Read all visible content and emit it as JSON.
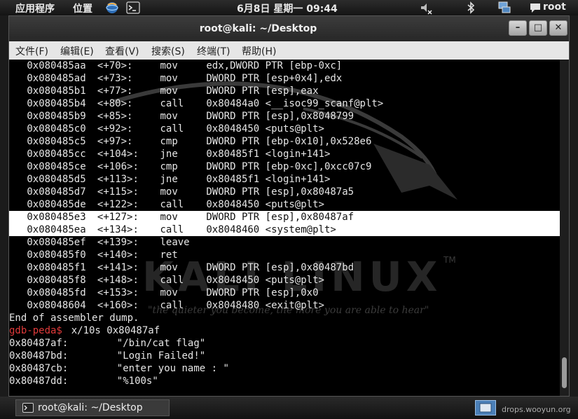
{
  "top_panel": {
    "apps_menu": "应用程序",
    "places_menu": "位置",
    "clock": "6月8日 星期一 09:44",
    "user": "root"
  },
  "window": {
    "title": "root@kali: ~/Desktop",
    "controls": {
      "minimize": "–",
      "maximize": "□",
      "close": "✕"
    }
  },
  "menubar": [
    "文件(F)",
    "编辑(E)",
    "查看(V)",
    "搜索(S)",
    "终端(T)",
    "帮助(H)"
  ],
  "disassembly": [
    {
      "addr": "0x080485aa",
      "off": "<+70>:",
      "op": "mov",
      "args": "edx,DWORD PTR [ebp-0xc]"
    },
    {
      "addr": "0x080485ad",
      "off": "<+73>:",
      "op": "mov",
      "args": "DWORD PTR [esp+0x4],edx"
    },
    {
      "addr": "0x080485b1",
      "off": "<+77>:",
      "op": "mov",
      "args": "DWORD PTR [esp],eax"
    },
    {
      "addr": "0x080485b4",
      "off": "<+80>:",
      "op": "call",
      "args": "0x80484a0 <__isoc99_scanf@plt>"
    },
    {
      "addr": "0x080485b9",
      "off": "<+85>:",
      "op": "mov",
      "args": "DWORD PTR [esp],0x8048799"
    },
    {
      "addr": "0x080485c0",
      "off": "<+92>:",
      "op": "call",
      "args": "0x8048450 <puts@plt>"
    },
    {
      "addr": "0x080485c5",
      "off": "<+97>:",
      "op": "cmp",
      "args": "DWORD PTR [ebp-0x10],0x528e6"
    },
    {
      "addr": "0x080485cc",
      "off": "<+104>:",
      "op": "jne",
      "args": "0x80485f1 <login+141>"
    },
    {
      "addr": "0x080485ce",
      "off": "<+106>:",
      "op": "cmp",
      "args": "DWORD PTR [ebp-0xc],0xcc07c9"
    },
    {
      "addr": "0x080485d5",
      "off": "<+113>:",
      "op": "jne",
      "args": "0x80485f1 <login+141>"
    },
    {
      "addr": "0x080485d7",
      "off": "<+115>:",
      "op": "mov",
      "args": "DWORD PTR [esp],0x80487a5"
    },
    {
      "addr": "0x080485de",
      "off": "<+122>:",
      "op": "call",
      "args": "0x8048450 <puts@plt>"
    },
    {
      "addr": "0x080485e3",
      "off": "<+127>:",
      "op": "mov",
      "args": "DWORD PTR [esp],0x80487af",
      "highlight": true
    },
    {
      "addr": "0x080485ea",
      "off": "<+134>:",
      "op": "call",
      "args": "0x8048460 <system@plt>",
      "highlight": true
    },
    {
      "addr": "0x080485ef",
      "off": "<+139>:",
      "op": "leave",
      "args": ""
    },
    {
      "addr": "0x080485f0",
      "off": "<+140>:",
      "op": "ret",
      "args": ""
    },
    {
      "addr": "0x080485f1",
      "off": "<+141>:",
      "op": "mov",
      "args": "DWORD PTR [esp],0x80487bd"
    },
    {
      "addr": "0x080485f8",
      "off": "<+148>:",
      "op": "call",
      "args": "0x8048450 <puts@plt>"
    },
    {
      "addr": "0x080485fd",
      "off": "<+153>:",
      "op": "mov",
      "args": "DWORD PTR [esp],0x0"
    },
    {
      "addr": "0x08048604",
      "off": "<+160>:",
      "op": "call",
      "args": "0x8048480 <exit@plt>"
    }
  ],
  "end_text": "End of assembler dump.",
  "prompt": "gdb-peda$",
  "command": "x/10s 0x80487af",
  "strings": [
    {
      "addr": "0x80487af:",
      "value": "\"/bin/cat flag\""
    },
    {
      "addr": "0x80487bd:",
      "value": "\"Login Failed!\""
    },
    {
      "addr": "0x80487cb:",
      "value": "\"enter you name : \""
    },
    {
      "addr": "0x80487dd:",
      "value": "\"%100s\""
    }
  ],
  "watermark": {
    "logo": "KALI LINUX",
    "trademark": "TM",
    "tagline": "\"the quieter you become, the more you are able to hear\""
  },
  "taskbar": {
    "item": "root@kali: ~/Desktop",
    "site_mark": "drops.wooyun.org"
  },
  "colors": {
    "prompt": "#e03a3a",
    "highlight_bg": "#ffffff",
    "terminal_bg": "#000000"
  }
}
